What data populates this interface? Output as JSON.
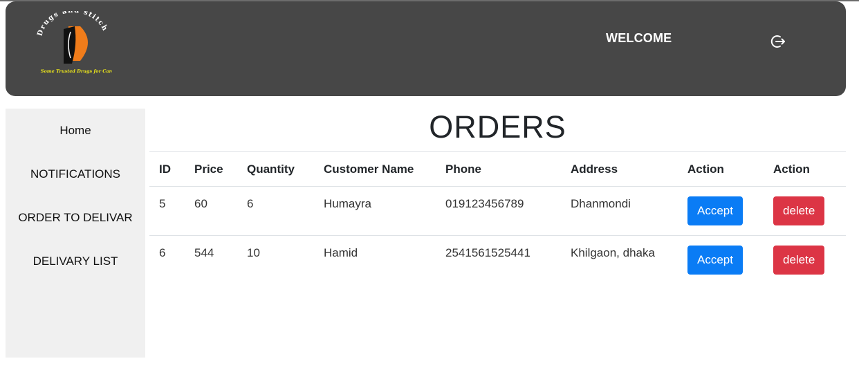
{
  "header": {
    "brand_name": "Drugs and stitch",
    "brand_tagline": "Some Trusted Drugs for Care",
    "welcome": "WELCOME",
    "logout_icon": "logout-icon",
    "colors": {
      "bar": "#474747",
      "logo_orange": "#f07c1a",
      "tagline_yellow": "#e8e21c"
    }
  },
  "sidebar": {
    "items": [
      {
        "label": "Home"
      },
      {
        "label": "NOTIFICATIONS"
      },
      {
        "label": "ORDER TO DELIVAR"
      },
      {
        "label": "DELIVARY LIST"
      }
    ]
  },
  "main": {
    "title": "ORDERS",
    "columns": [
      "ID",
      "Price",
      "Quantity",
      "Customer Name",
      "Phone",
      "Address",
      "Action",
      "Action"
    ],
    "rows": [
      {
        "id": "5",
        "price": "60",
        "quantity": "6",
        "customer": "Humayra",
        "phone": "019123456789",
        "address": "Dhanmondi",
        "accept": "Accept",
        "delete": "delete"
      },
      {
        "id": "6",
        "price": "544",
        "quantity": "10",
        "customer": "Hamid",
        "phone": "2541561525441",
        "address": "Khilgaon, dhaka",
        "accept": "Accept",
        "delete": "delete"
      }
    ],
    "colors": {
      "accept": "#0a7cf5",
      "delete": "#dc3545"
    }
  }
}
